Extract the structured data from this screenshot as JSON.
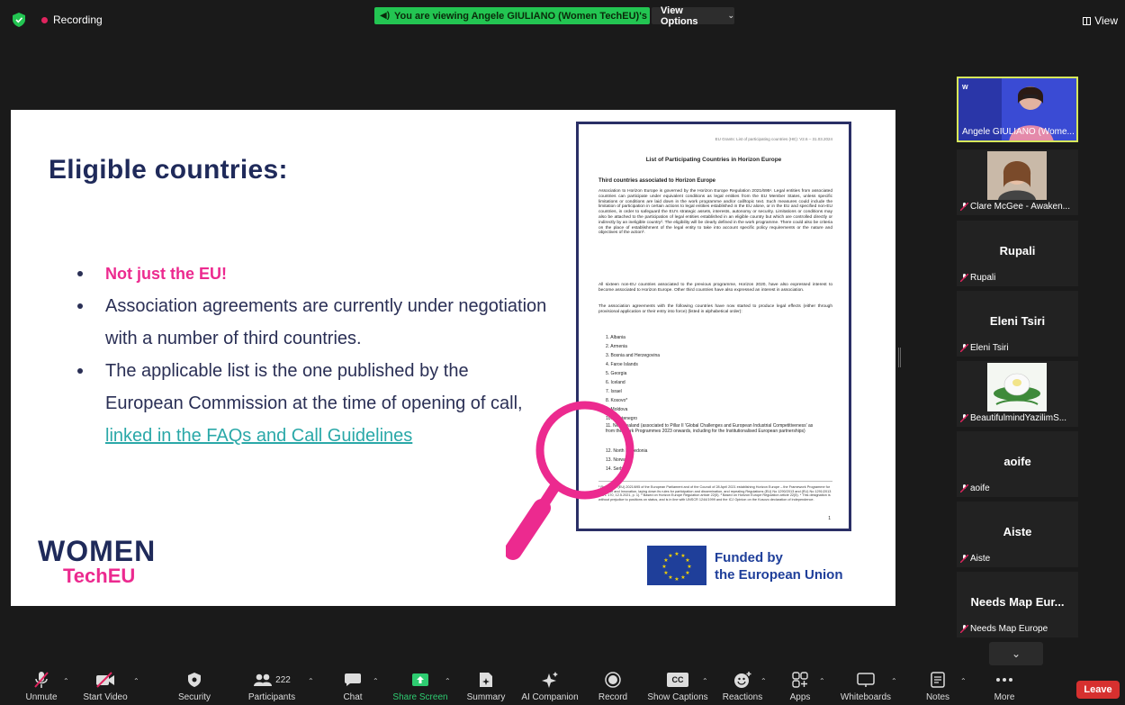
{
  "topbar": {
    "recording_label": "Recording",
    "share_banner": "You are viewing Angele GIULIANO (Women TechEU)'s screen",
    "view_options_label": "View Options",
    "view_label": "View"
  },
  "slide": {
    "title": "Eligible countries:",
    "bullets": [
      "Not just the EU!",
      "Association agreements are currently under negotiation with a number of third countries.",
      "The applicable list is the one published by the European Commission at the time of opening of call,"
    ],
    "link_text": "linked in the FAQs and Call Guidelines",
    "logo_top": "WOMEN",
    "logo_bottom": "TechEU",
    "eu_line1": "Funded by",
    "eu_line2": "the European Union",
    "doc": {
      "header": "EU Grants: List of participating countries (HE): V2.6 – 31.03.2024",
      "title": "List of Participating Countries in Horizon Europe",
      "subtitle": "Third countries associated to Horizon Europe",
      "para1": "Association to Horizon Europe is governed by the Horizon Europe Regulation 2021/695¹. Legal entities from associated countries can participate under equivalent conditions as legal entities from the EU Member States, unless specific limitations or conditions are laid down in the work programme and/or call/topic text. Such measures could include the limitation of participation in certain actions to legal entities established in the EU alone, or in the EU and specified non-EU countries, in order to safeguard the EU's strategic assets, interests, autonomy or security. Limitations or conditions may also be attached to the participation of legal entities established in an eligible country but which are controlled directly or indirectly by an ineligible country². The eligibility will be clearly defined in the work programme. There could also be criteria on the place of establishment of the legal entity to take into account specific policy requirements or the nature and objectives of the action³.",
      "para2": "All sixteen non-EU countries associated to the previous programme, Horizon 2020, have also expressed interest to become associated to Horizon Europe. Other third countries have also expressed an interest in association.",
      "para3": "The association agreements with the following countries have now started to produce legal effects (either through provisional application or their entry into force) (listed in alphabetical order):",
      "countries": [
        "1. Albania",
        "2. Armenia",
        "3. Bosnia and Herzegovina",
        "4. Faroe Islands",
        "5. Georgia",
        "6. Iceland",
        "7. Israel",
        "8. Kosovo*",
        "9. Moldova",
        "10. Montenegro",
        "11. New Zealand (associated to Pillar II 'Global Challenges and European Industrial Competitiveness' as from the Work Programmes 2023 onwards, including for the Institutionalised European partnerships)",
        "12. North Macedonia",
        "13. Norway",
        "14. Serbia"
      ],
      "footnotes": "¹ Regulation (EU) 2021/695 of the European Parliament and of the Council of 28 April 2021 establishing Horizon Europe – the Framework Programme for Research and Innovation, laying down its rules for participation and dissemination, and repealing Regulations (EU) No 1290/2013 and (EU) No 1291/2013 (OJ L 170, 12.5.2021, p. 1). ² Based on Horizon Europe Regulation article 22(5). ³ Based on Horizon Europe Regulation article 22(5). * This designation is without prejudice to positions on status, and is in line with UNSCR 1244/1999 and the ICJ Opinion on the Kosovo declaration of independence.",
      "page_number": "1"
    }
  },
  "participants": [
    {
      "label": "Angele GIULIANO (Wome...",
      "center": "",
      "muted": false,
      "video": true
    },
    {
      "label": "Clare McGee - Awaken...",
      "center": "",
      "muted": true,
      "video": true
    },
    {
      "label": "Rupali",
      "center": "Rupali",
      "muted": true,
      "video": false
    },
    {
      "label": "Eleni Tsiri",
      "center": "Eleni Tsiri",
      "muted": true,
      "video": false
    },
    {
      "label": "BeautifulmindYazilimS...",
      "center": "",
      "muted": true,
      "video": true
    },
    {
      "label": "aoife",
      "center": "aoife",
      "muted": true,
      "video": false
    },
    {
      "label": "Aiste",
      "center": "Aiste",
      "muted": true,
      "video": false
    },
    {
      "label": "Needs Map Europe",
      "center": "Needs Map Eur...",
      "muted": true,
      "video": false
    }
  ],
  "toolbar": {
    "unmute": "Unmute",
    "start_video": "Start Video",
    "security": "Security",
    "participants": "Participants",
    "participants_count": "222",
    "chat": "Chat",
    "share_screen": "Share Screen",
    "summary": "Summary",
    "ai_companion": "AI Companion",
    "record": "Record",
    "show_captions": "Show Captions",
    "reactions": "Reactions",
    "apps": "Apps",
    "whiteboards": "Whiteboards",
    "notes": "Notes",
    "more": "More",
    "leave": "Leave",
    "cc_glyph": "CC"
  },
  "colors": {
    "accent_pink": "#ec2a8f",
    "navy": "#1f2a5a",
    "share_green": "#23c552",
    "leave_red": "#d6302f",
    "active_speaker_border": "#d7e85a"
  }
}
